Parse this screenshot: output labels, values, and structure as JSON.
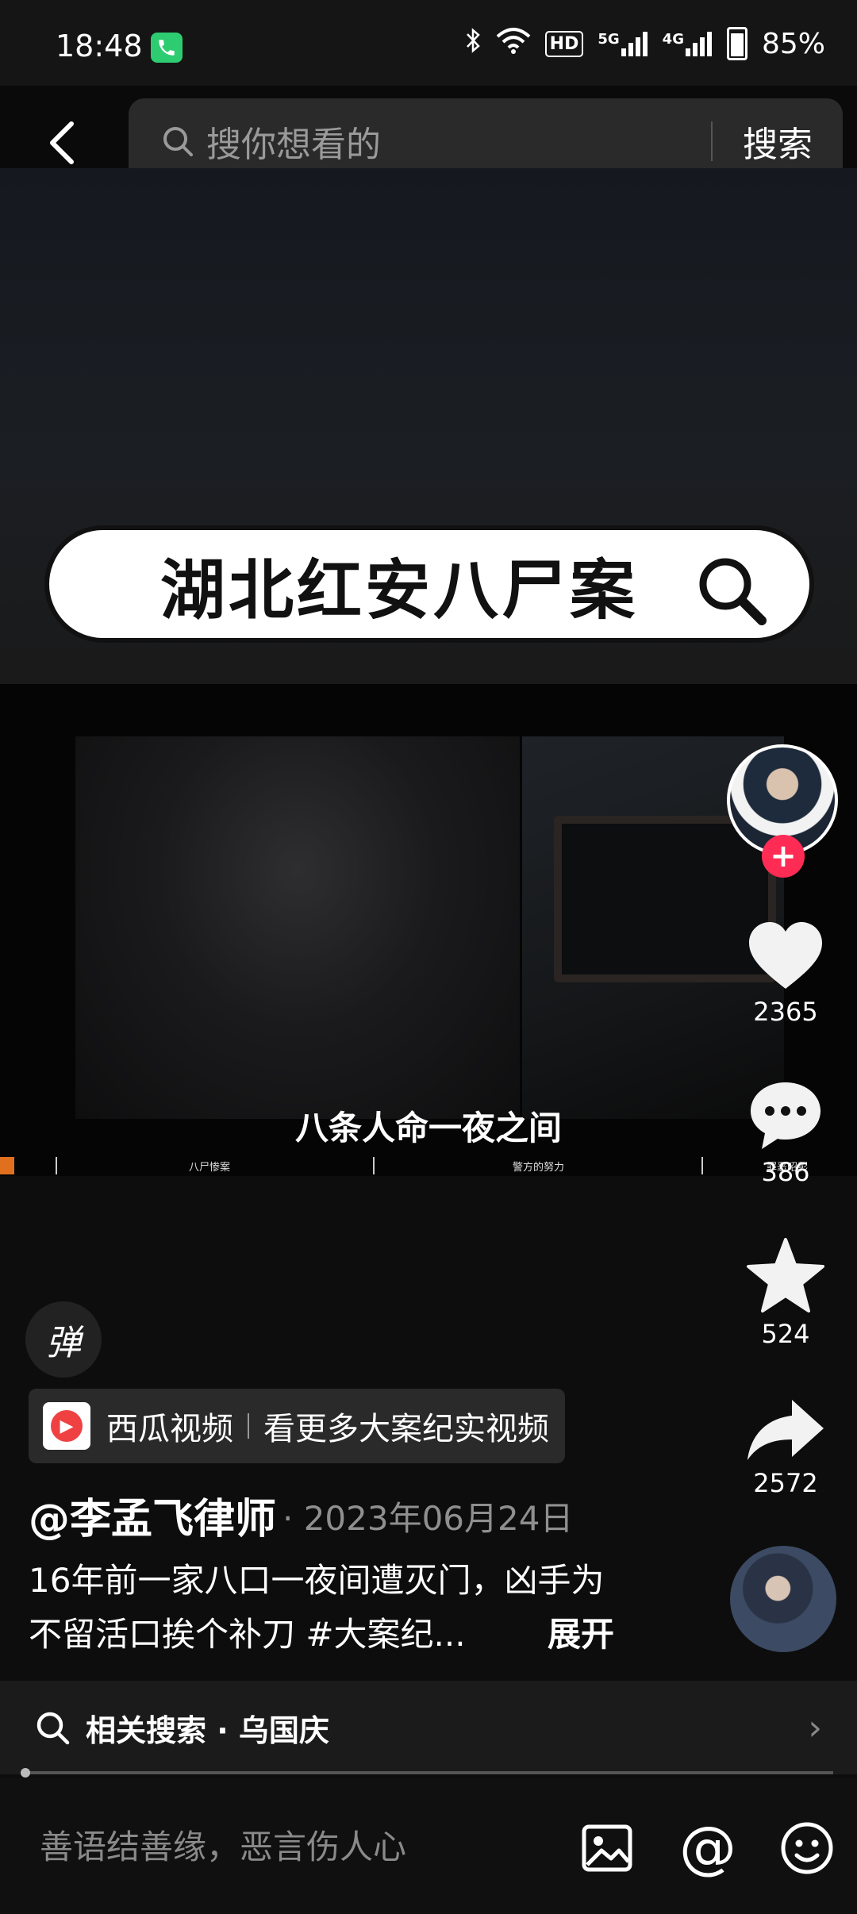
{
  "status_bar": {
    "time": "18:48",
    "network_5g": "5G",
    "network_4g": "4G",
    "hd": "HD",
    "battery": "85%"
  },
  "search": {
    "placeholder": "搜你想看的",
    "button_label": "搜索"
  },
  "video": {
    "title_card": "湖北红安八尸案",
    "subtitle": "八条人命一夜之间",
    "chapters": [
      "八尸惨案",
      "警方的努力",
      "罪恶昭彰"
    ]
  },
  "actions": {
    "likes": "2365",
    "comments": "386",
    "favorites": "524",
    "shares": "2572"
  },
  "post": {
    "danmu_label": "弹",
    "source_app": "西瓜视频",
    "source_promo": "看更多大案纪实视频",
    "author": "@李孟飞律师",
    "date": "· 2023年06月24日",
    "caption": "16年前一家八口一夜间遭灭门，凶手为不留活口挨个补刀 #大案纪...",
    "expand_label": "展开"
  },
  "related_search": {
    "label": "相关搜索 · 乌国庆"
  },
  "comment_box": {
    "placeholder": "善语结善缘，恶言伤人心",
    "at_label": "@"
  },
  "colors": {
    "accent_red": "#fe2c55",
    "xigua_red": "#f04142",
    "call_green": "#2ecc71"
  }
}
